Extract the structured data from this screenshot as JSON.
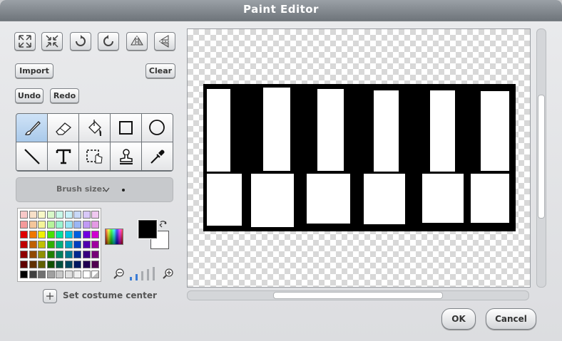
{
  "window": {
    "title": "Paint Editor"
  },
  "buttons": {
    "import": "Import",
    "clear": "Clear",
    "undo": "Undo",
    "redo": "Redo",
    "ok": "OK",
    "cancel": "Cancel",
    "set_costume_center": "Set costume center"
  },
  "top_icons": [
    "grow-icon",
    "shrink-icon",
    "rotate-left-icon",
    "rotate-right-icon",
    "flip-horizontal-icon",
    "flip-vertical-icon"
  ],
  "tools": [
    "paintbrush-icon",
    "eraser-icon",
    "fill-bucket-icon",
    "rectangle-icon",
    "ellipse-icon",
    "line-icon",
    "text-icon",
    "select-icon",
    "stamp-icon",
    "eyedropper-icon"
  ],
  "selected_tool": "paintbrush-icon",
  "brush": {
    "label": "Brush size:"
  },
  "colors": {
    "foreground": "#000000",
    "background": "#ffffff",
    "palette": [
      [
        "#f8c8c8",
        "#f8e0c8",
        "#f8f8c8",
        "#d8f8c8",
        "#c8f8e8",
        "#c8f0f8",
        "#c8d8f8",
        "#d8c8f8",
        "#f0c8f0"
      ],
      [
        "#f49a9a",
        "#f4c69a",
        "#f4f49a",
        "#b6f49a",
        "#9af4d0",
        "#9ae4f4",
        "#9ab6f4",
        "#c09af4",
        "#e49ae4"
      ],
      [
        "#e00000",
        "#f07800",
        "#f0f000",
        "#48e000",
        "#00e0a0",
        "#00c0e0",
        "#0060e0",
        "#7000e0",
        "#d000d0"
      ],
      [
        "#c00000",
        "#c06000",
        "#c0c000",
        "#30b000",
        "#00b080",
        "#00a0c0",
        "#0040c0",
        "#5000b0",
        "#a000a0"
      ],
      [
        "#900000",
        "#904800",
        "#909000",
        "#208000",
        "#008060",
        "#007890",
        "#002890",
        "#380080",
        "#780078"
      ],
      [
        "#600000",
        "#603000",
        "#606000",
        "#105000",
        "#005040",
        "#004860",
        "#001860",
        "#200050",
        "#500050"
      ],
      [
        "#000000",
        "#404040",
        "#707070",
        "#a0a0a0",
        "#c8c8c8",
        "#e0e0e0",
        "#f0f0f0",
        "#ffffff",
        "transparent"
      ]
    ]
  }
}
